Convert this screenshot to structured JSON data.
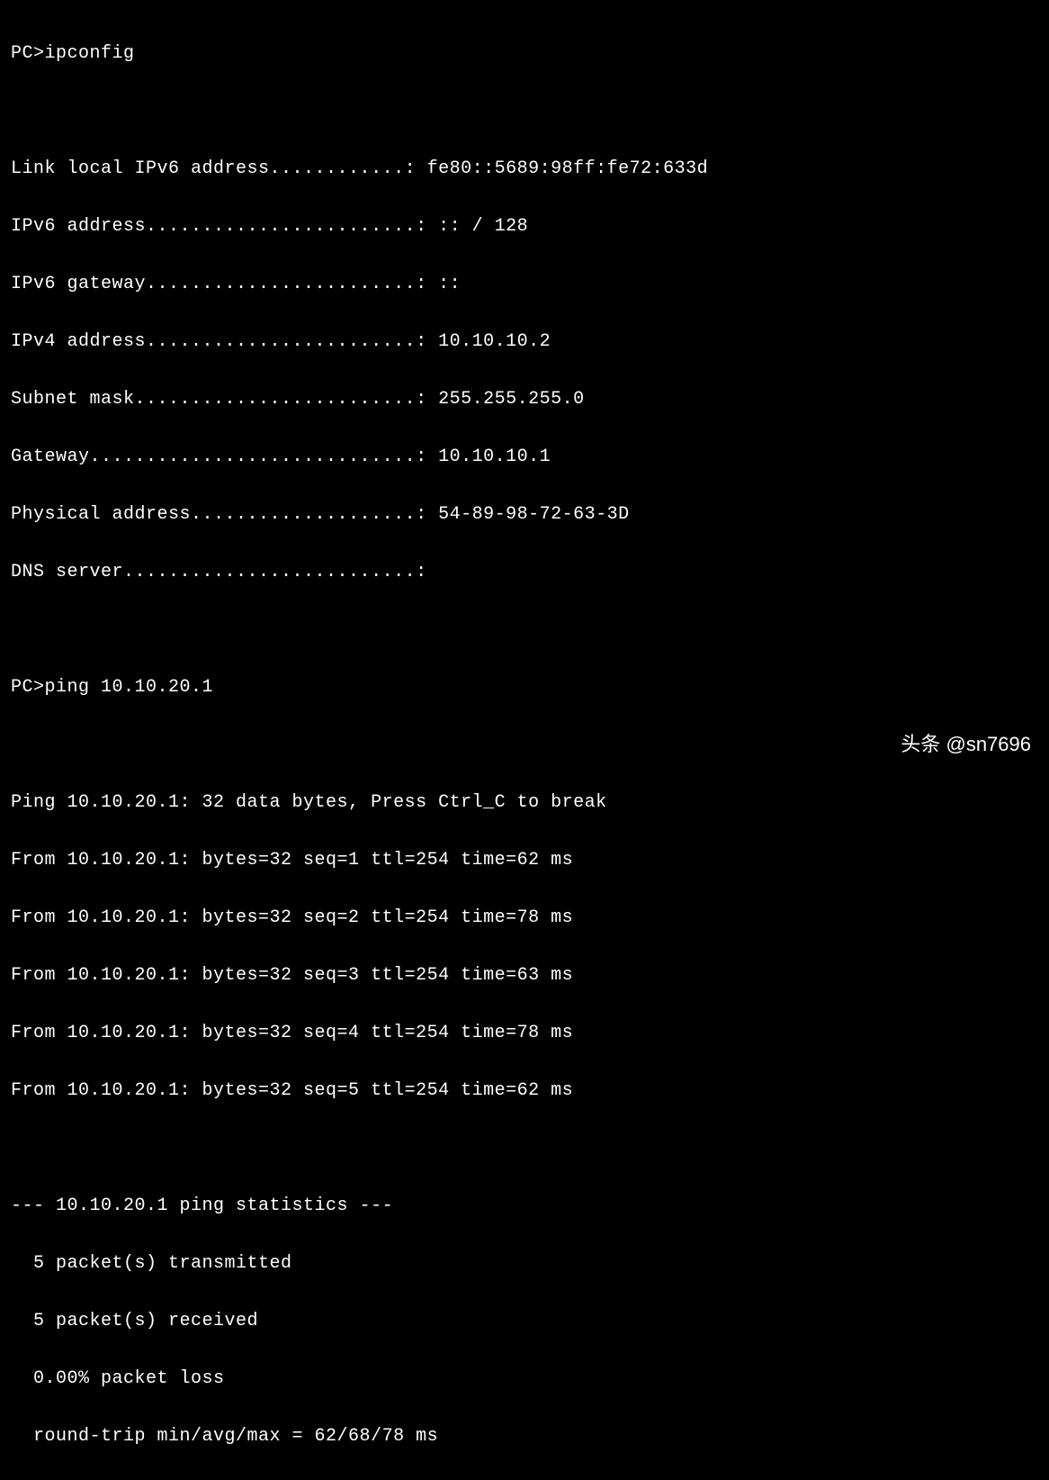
{
  "prompt": "PC>",
  "cmd_ipconfig": "ipconfig",
  "cmd_ping": "ping 10.10.20.1",
  "ipconfig": {
    "link_local_ipv6_label": "Link local IPv6 address............",
    "link_local_ipv6_value": "fe80::5689:98ff:fe72:633d",
    "ipv6_address_label": "IPv6 address........................",
    "ipv6_address_value": ":: / 128",
    "ipv6_gateway_label": "IPv6 gateway........................",
    "ipv6_gateway_value": "::",
    "ipv4_address_label": "IPv4 address........................",
    "ipv4_address_value": "10.10.10.2",
    "subnet_mask_label": "Subnet mask.........................",
    "subnet_mask_value": "255.255.255.0",
    "gateway_label": "Gateway.............................",
    "gateway_value": "10.10.10.1",
    "physical_address_label": "Physical address....................",
    "physical_address_value": "54-89-98-72-63-3D",
    "dns_server_label": "DNS server..........................",
    "dns_server_value": ""
  },
  "ping": {
    "target": "10.10.20.1",
    "header": "Ping 10.10.20.1: 32 data bytes, Press Ctrl_C to break",
    "replies": [
      "From 10.10.20.1: bytes=32 seq=1 ttl=254 time=62 ms",
      "From 10.10.20.1: bytes=32 seq=2 ttl=254 time=78 ms",
      "From 10.10.20.1: bytes=32 seq=3 ttl=254 time=63 ms",
      "From 10.10.20.1: bytes=32 seq=4 ttl=254 time=78 ms",
      "From 10.10.20.1: bytes=32 seq=5 ttl=254 time=62 ms"
    ],
    "stats_header": "--- 10.10.20.1 ping statistics ---",
    "stats_transmitted": "  5 packet(s) transmitted",
    "stats_received": "  5 packet(s) received",
    "stats_loss": "  0.00% packet loss",
    "stats_roundtrip": "  round-trip min/avg/max = 62/68/78 ms"
  },
  "watermark": "头条 @sn7696"
}
